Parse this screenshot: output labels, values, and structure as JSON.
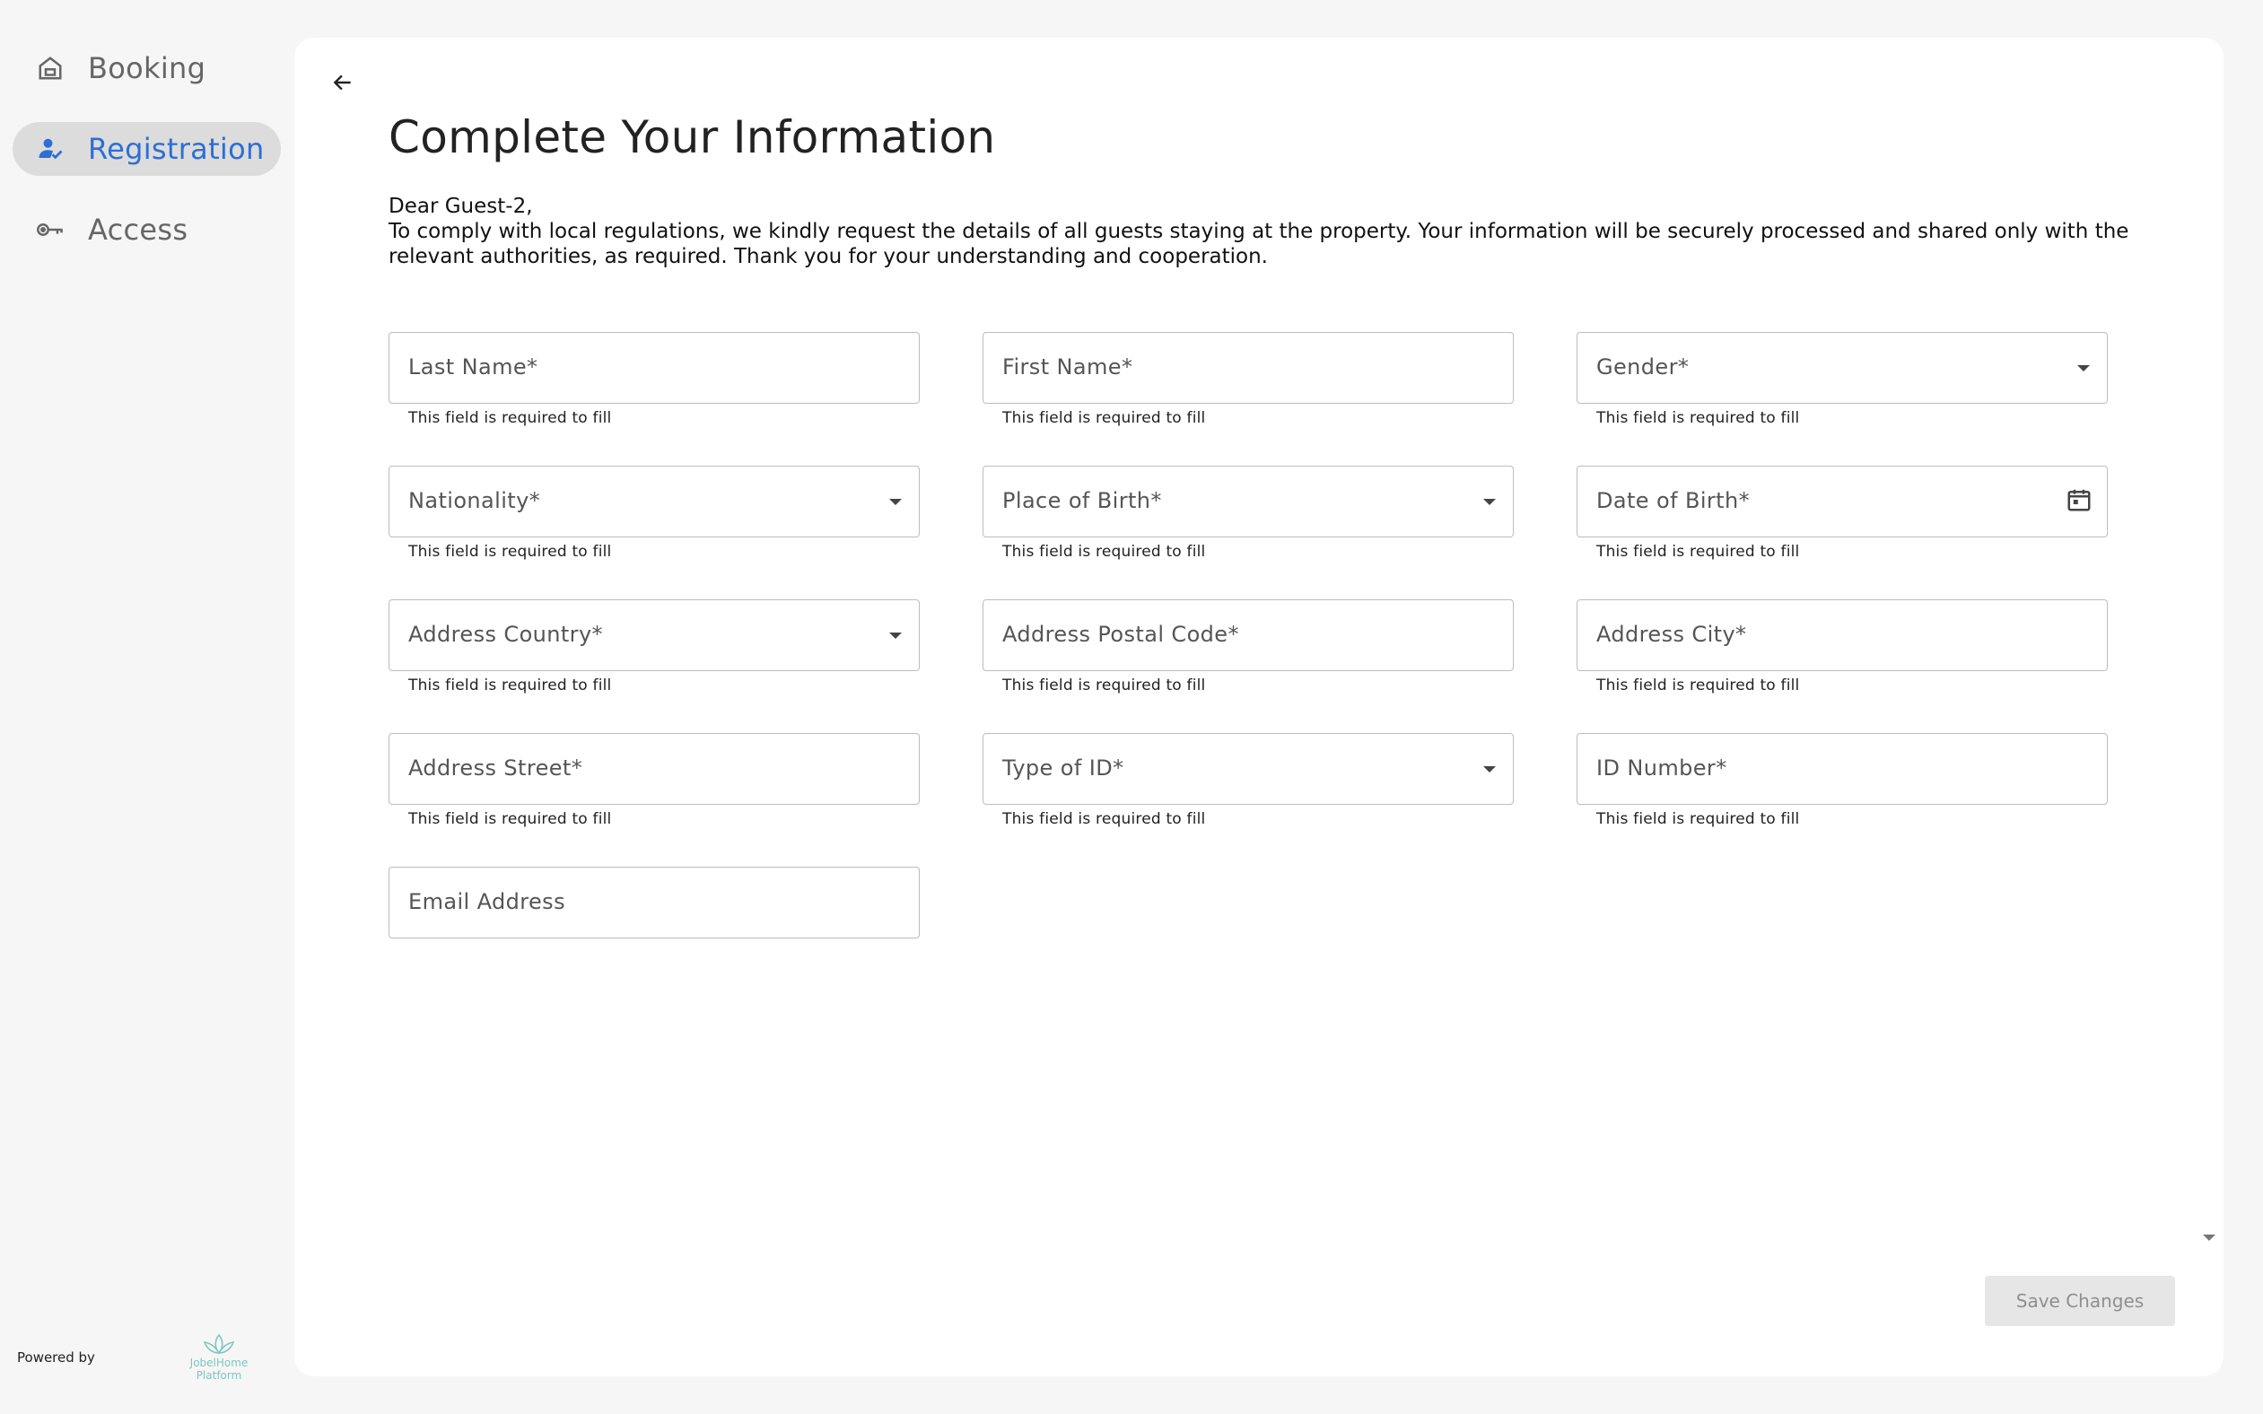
{
  "sidebar": {
    "items": [
      {
        "label": "Booking",
        "icon": "house-icon"
      },
      {
        "label": "Registration",
        "icon": "person-check-icon",
        "active": true
      },
      {
        "label": "Access",
        "icon": "key-icon"
      }
    ],
    "powered_by": "Powered by",
    "brand_line1": "JobelHome",
    "brand_line2": "Platform"
  },
  "form": {
    "title": "Complete Your Information",
    "greeting": "Dear Guest-2,",
    "intro": "To comply with local regulations, we kindly request the details of all guests staying at the property. Your information will be securely processed and shared only with the relevant authorities, as required. Thank you for your understanding and cooperation.",
    "helper": "This field is required to fill",
    "fields": {
      "last_name": "Last Name*",
      "first_name": "First Name*",
      "gender": "Gender*",
      "nationality": "Nationality*",
      "place_of_birth": "Place of Birth*",
      "date_of_birth": "Date of Birth*",
      "address_country": "Address Country*",
      "address_postal_code": "Address Postal Code*",
      "address_city": "Address City*",
      "address_street": "Address Street*",
      "type_of_id": "Type of ID*",
      "id_number": "ID Number*",
      "email": "Email Address"
    },
    "save_label": "Save Changes"
  },
  "colors": {
    "accent": "#2b6fd6",
    "active_bg": "#dcdcdc",
    "brand": "#7cc7bd"
  }
}
